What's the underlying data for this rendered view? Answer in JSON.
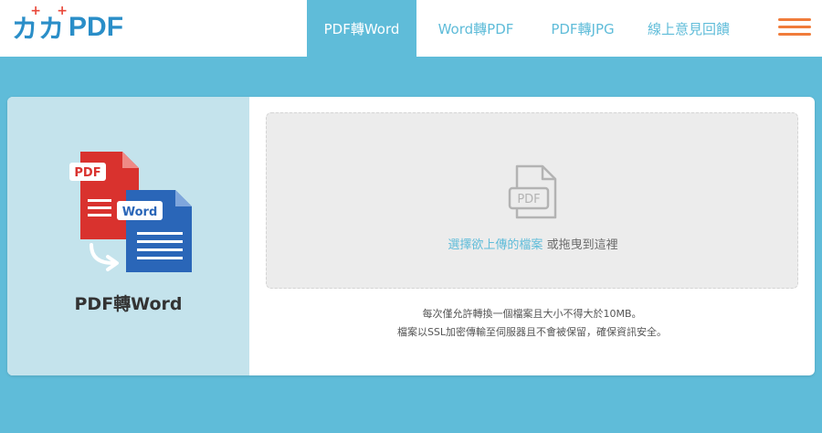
{
  "brand": {
    "logo_glyphs": [
      "カ",
      "カ"
    ],
    "logo_text": "PDF",
    "logo_color": "#2a8ec8",
    "logo_accent": "#e9483a"
  },
  "nav": {
    "items": [
      {
        "label": "PDF轉Word",
        "active": true
      },
      {
        "label": "Word轉PDF",
        "active": false
      },
      {
        "label": "PDF轉JPG",
        "active": false
      },
      {
        "label": "線上意見回饋",
        "active": false
      }
    ],
    "menu_icon": "hamburger-menu-icon"
  },
  "tool": {
    "title": "PDF轉Word",
    "icon_badges": {
      "source": "PDF",
      "target": "Word"
    }
  },
  "upload": {
    "icon_label": "PDF",
    "link_text": "選擇欲上傳的檔案",
    "suffix_text": "或拖曳到這裡"
  },
  "notes": {
    "line1": "每次僅允許轉換一個檔案且大小不得大於10MB。",
    "line2": "檔案以SSL加密傳輸至伺服器且不會被保留，確保資訊安全。"
  },
  "colors": {
    "accent": "#5fbcd9",
    "page_background": "#5fbcd9",
    "menu_icon": "#f07c3b",
    "pdf_red": "#d9322e",
    "word_blue": "#2a66b8"
  }
}
